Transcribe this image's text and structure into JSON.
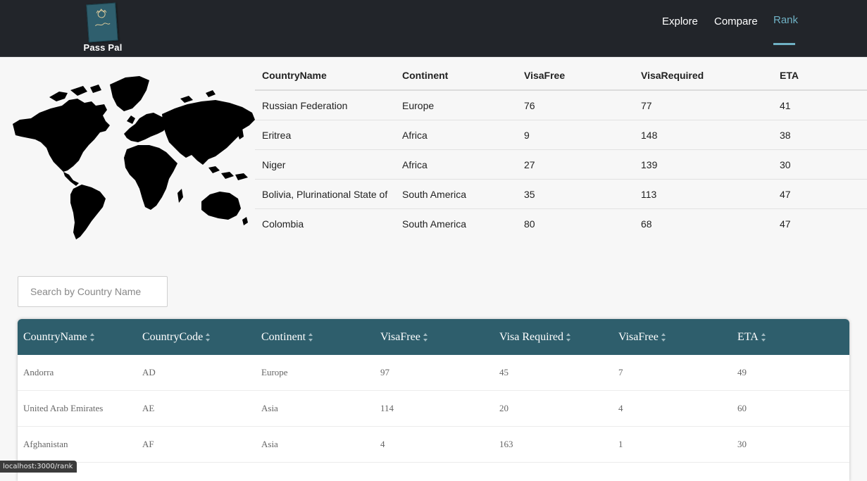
{
  "nav": {
    "brand": "Pass Pal",
    "links": [
      {
        "label": "Explore",
        "active": false
      },
      {
        "label": "Compare",
        "active": false
      },
      {
        "label": "Rank",
        "active": true
      }
    ],
    "accent_color": "#6fb1c4"
  },
  "map_icon": "world-map",
  "top_table": {
    "headers": [
      "CountryName",
      "Continent",
      "VisaFree",
      "VisaRequired",
      "ETA"
    ],
    "rows": [
      [
        "Russian Federation",
        "Europe",
        "76",
        "77",
        "41"
      ],
      [
        "Eritrea",
        "Africa",
        "9",
        "148",
        "38"
      ],
      [
        "Niger",
        "Africa",
        "27",
        "139",
        "30"
      ],
      [
        "Bolivia, Plurinational State of",
        "South America",
        "35",
        "113",
        "47"
      ],
      [
        "Colombia",
        "South America",
        "80",
        "68",
        "47"
      ]
    ]
  },
  "search": {
    "placeholder": "Search by Country Name",
    "value": ""
  },
  "main_table": {
    "header_color": "#2e5e6c",
    "headers": [
      "CountryName",
      "CountryCode",
      "Continent",
      "VisaFree",
      "Visa Required",
      "VisaFree",
      "ETA"
    ],
    "rows": [
      [
        "Andorra",
        "AD",
        "Europe",
        "97",
        "45",
        "7",
        "49"
      ],
      [
        "United Arab Emirates",
        "AE",
        "Asia",
        "114",
        "20",
        "4",
        "60"
      ],
      [
        "Afghanistan",
        "AF",
        "Asia",
        "4",
        "163",
        "1",
        "30"
      ]
    ]
  },
  "status_url": "localhost:3000/rank"
}
